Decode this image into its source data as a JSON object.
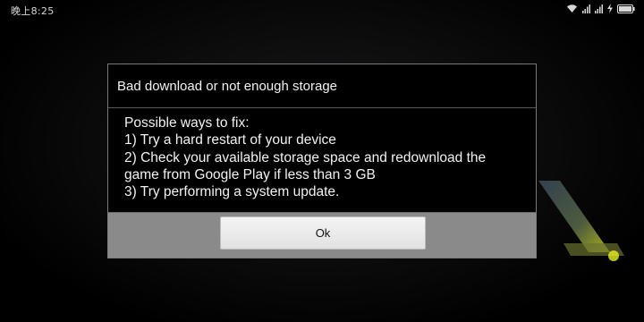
{
  "status_bar": {
    "time": "晚上8:25",
    "icons": [
      "wifi-icon",
      "signal-icon",
      "signal-icon",
      "charging-icon",
      "battery-icon"
    ]
  },
  "dialog": {
    "title": "Bad download or not enough storage",
    "body_lines": [
      "Possible ways to fix:",
      "1) Try a hard restart of your device",
      "2) Check your available storage space and redownload the",
      "game from Google Play if less than 3 GB",
      "3) Try performing a system update."
    ],
    "ok_label": "Ok"
  },
  "colors": {
    "dialog_background": "#000000",
    "footer_background": "#8a8a8a",
    "button_background": "#eeeeee"
  }
}
